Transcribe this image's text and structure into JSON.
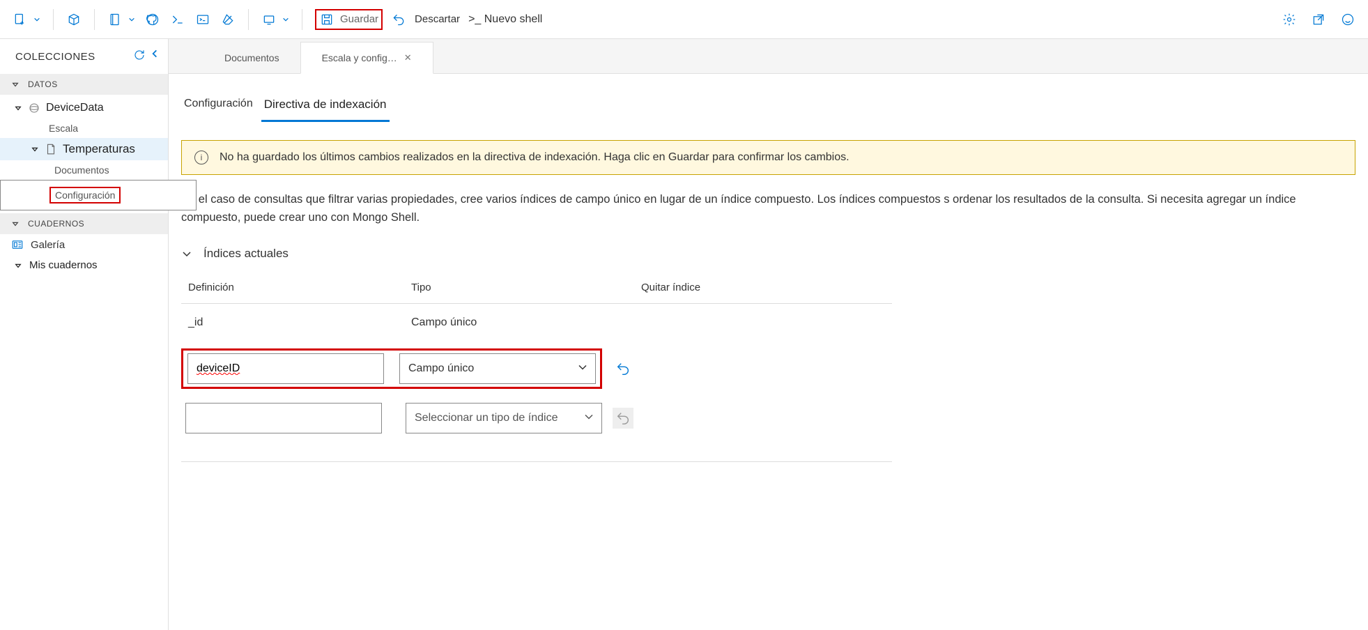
{
  "toolbar": {
    "save_label": "Guardar",
    "discard_label": "Descartar",
    "newshell_label": ">_ Nuevo shell"
  },
  "sidebar": {
    "title": "COLECCIONES",
    "section_data": "DATOS",
    "db_name": "DeviceData",
    "db_scale": "Escala",
    "coll_name": "Temperaturas",
    "coll_docs": "Documentos",
    "coll_config": "Configuración",
    "section_nb": "CUADERNOS",
    "gallery": "Galería",
    "mynb": "Mis cuadernos"
  },
  "tabs": {
    "documents": "Documentos",
    "scale_config": "Escala y config…"
  },
  "subtabs": {
    "config": "Configuración",
    "indexing": "Directiva de indexación"
  },
  "banner": "No ha guardado los últimos cambios realizados en la directiva de indexación. Haga clic en Guardar para confirmar los cambios.",
  "desc": "En el caso de consultas que filtrar varias propiedades, cree varios índices de campo único en lugar de un índice compuesto. Los índices compuestos s ordenar los resultados de la consulta. Si necesita agregar un índice compuesto, puede crear uno con Mongo Shell.",
  "indexes": {
    "section_title": "Índices actuales",
    "col_def": "Definición",
    "col_type": "Tipo",
    "col_remove": "Quitar índice",
    "rows": [
      {
        "def": "_id",
        "type": "Campo único"
      },
      {
        "def": "deviceID",
        "type": "Campo único"
      },
      {
        "def": "",
        "type_placeholder": "Seleccionar un tipo de índice"
      }
    ]
  }
}
